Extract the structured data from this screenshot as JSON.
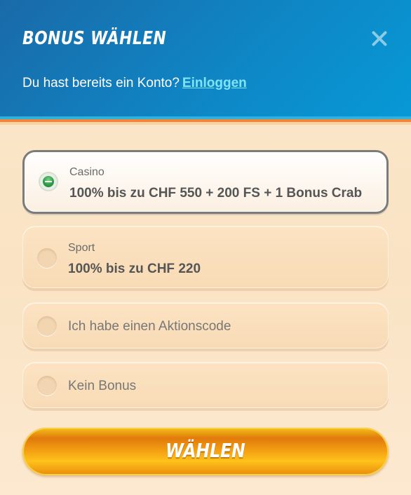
{
  "header": {
    "title": "BONUS WÄHLEN",
    "close_icon": "close-icon",
    "login_prompt": "Du hast bereits ein Konto?",
    "login_link": "Einloggen"
  },
  "options": [
    {
      "label": "Casino",
      "value": "100% bis zu CHF 550 + 200 FS + 1 Bonus Crab",
      "selected": true
    },
    {
      "label": "Sport",
      "value": "100% bis zu CHF 220",
      "selected": false
    },
    {
      "label": "Ich habe einen Aktionscode",
      "selected": false
    },
    {
      "label": "Kein Bonus",
      "selected": false
    }
  ],
  "cta": {
    "label": "WÄHLEN"
  },
  "colors": {
    "header_blue": "#0f85c4",
    "link_cyan": "#7fe4f5",
    "accent_orange": "#f0863b",
    "selected_green": "#2f9a48",
    "cta_yellow": "#ffc21a"
  }
}
